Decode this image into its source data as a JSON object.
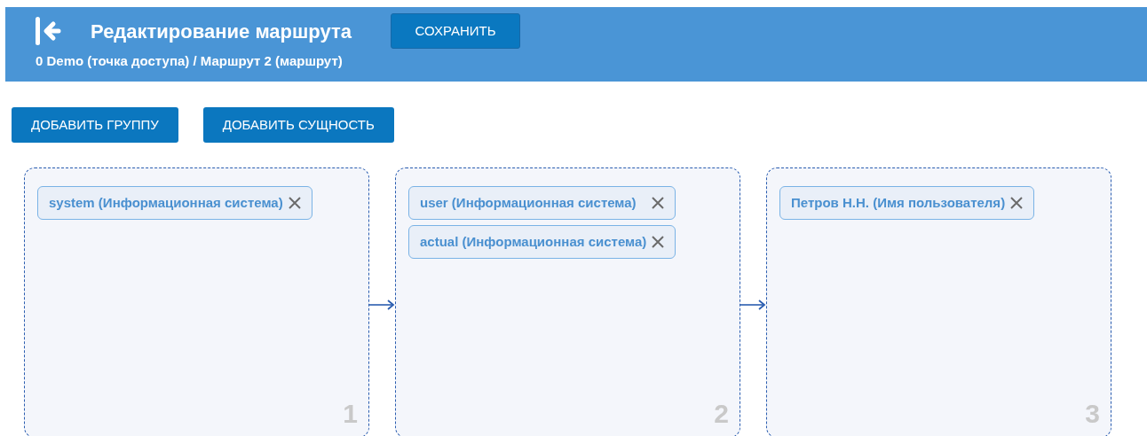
{
  "header": {
    "title": "Редактирование маршрута",
    "save_button": "СОХРАНИТЬ",
    "breadcrumb": "0 Demo (точка доступа) / Маршрут 2 (маршрут)"
  },
  "toolbar": [
    "ДОБАВИТЬ ГРУППУ",
    "ДОБАВИТЬ СУЩНОСТЬ"
  ],
  "groups": [
    {
      "number": "1",
      "entities": [
        "system (Информационная система)"
      ]
    },
    {
      "number": "2",
      "entities": [
        "user (Информационная система)",
        "actual (Информационная система)"
      ]
    },
    {
      "number": "3",
      "entities": [
        "Петров Н.Н. (Имя пользователя)"
      ]
    }
  ]
}
